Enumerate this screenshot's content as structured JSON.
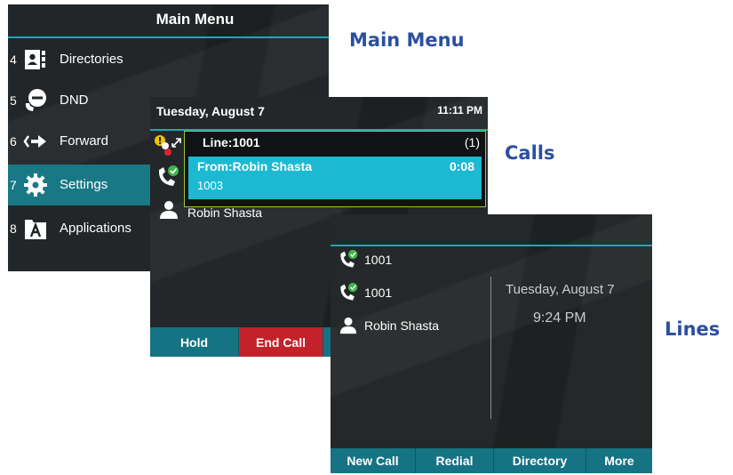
{
  "captions": {
    "main_menu": "Main Menu",
    "calls": "Calls",
    "lines": "Lines"
  },
  "main_menu": {
    "title": "Main Menu",
    "items": [
      {
        "num": "4",
        "label": "Directories",
        "icon": "directories-icon",
        "selected": false
      },
      {
        "num": "5",
        "label": "DND",
        "icon": "dnd-icon",
        "selected": false
      },
      {
        "num": "6",
        "label": "Forward",
        "icon": "forward-icon",
        "selected": false
      },
      {
        "num": "7",
        "label": "Settings",
        "icon": "gear-icon",
        "selected": true
      },
      {
        "num": "8",
        "label": "Applications",
        "icon": "applications-icon",
        "selected": false
      }
    ]
  },
  "calls": {
    "date": "Tuesday, August 7",
    "time": "11:11 PM",
    "line_label": "Line:1001",
    "line_count": "(1)",
    "active_call": {
      "from": "From:Robin Shasta",
      "duration": "0:08",
      "number": "1003"
    },
    "contact": "Robin Shasta",
    "softkeys": [
      {
        "label": "Hold"
      },
      {
        "label": "End Call"
      }
    ]
  },
  "lines": {
    "items": [
      {
        "label": "1001",
        "icon": "registered-line-icon"
      },
      {
        "label": "1001",
        "icon": "registered-line-icon"
      },
      {
        "label": "Robin Shasta",
        "icon": "contact-icon"
      }
    ],
    "date": "Tuesday, August 7",
    "time": "9:24 PM",
    "softkeys": [
      {
        "label": "New Call"
      },
      {
        "label": "Redial"
      },
      {
        "label": "Directory"
      },
      {
        "label": "More"
      }
    ]
  },
  "colors": {
    "accent": "#1aa9b8",
    "softkey": "#157384",
    "selected_menu": "#187885",
    "active_call": "#1cb9d3",
    "end_call": "#c4222a",
    "caption": "#2b4fa0"
  }
}
